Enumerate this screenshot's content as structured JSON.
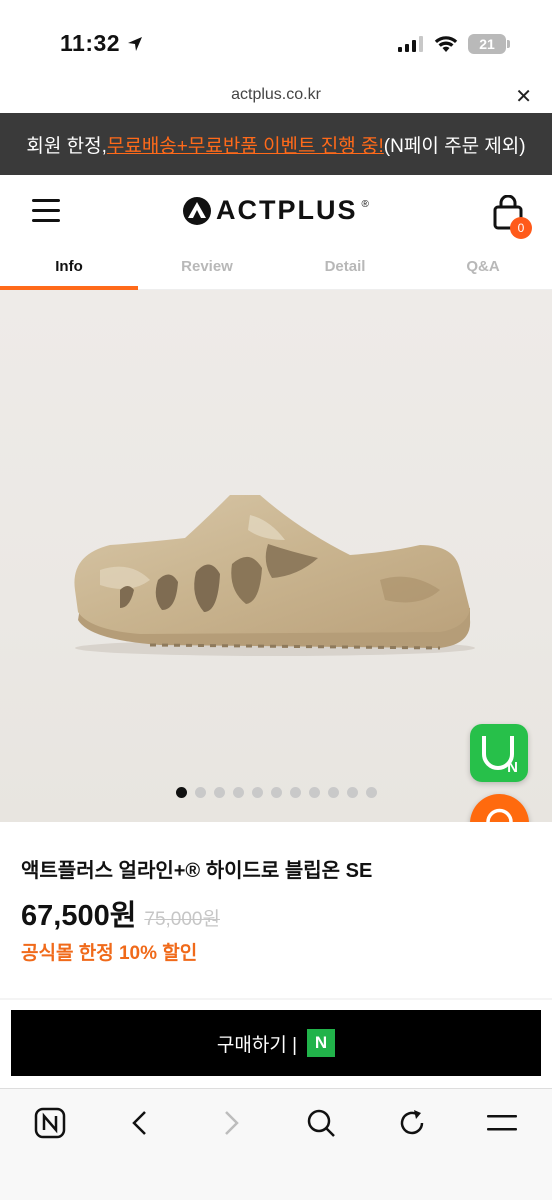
{
  "status_bar": {
    "time": "11:32",
    "battery": "21"
  },
  "url_bar": {
    "url": "actplus.co.kr",
    "close_label": "✕"
  },
  "promo": {
    "prefix": "회원 한정, ",
    "highlight": "무료배송+무료반품 이벤트 진행 중!",
    "suffix": " (N페이 주문 제외)"
  },
  "header": {
    "logo_text": "ACTPLUS",
    "logo_mark": "®",
    "cart_count": "0"
  },
  "tabs": [
    {
      "label": "Info",
      "active": true
    },
    {
      "label": "Review",
      "active": false
    },
    {
      "label": "Detail",
      "active": false
    },
    {
      "label": "Q&A",
      "active": false
    }
  ],
  "gallery": {
    "total_images": 11,
    "current_index": 1
  },
  "floating": {
    "naver_label": "N"
  },
  "product": {
    "name": "액트플러스 얼라인+® 하이드로 블립온 SE",
    "price": "67,500원",
    "original_price": "75,000원",
    "discount_text": "공식몰 한정 10% 할인"
  },
  "buy": {
    "label": "구매하기 |",
    "naver_badge": "N"
  },
  "browser_toolbar": {
    "home_badge": "N"
  },
  "colors": {
    "accent": "#ff6a1a",
    "naver_green": "#27c04a",
    "banner_bg": "#3a3a3a"
  },
  "icons": [
    "location-arrow-icon",
    "signal-icon",
    "wifi-icon",
    "battery-icon",
    "close-icon",
    "menu-icon",
    "cart-icon",
    "naver-shopping-icon",
    "headset-icon",
    "naver-home-icon",
    "back-icon",
    "forward-icon",
    "search-icon",
    "reload-icon",
    "hamburger-icon"
  ]
}
